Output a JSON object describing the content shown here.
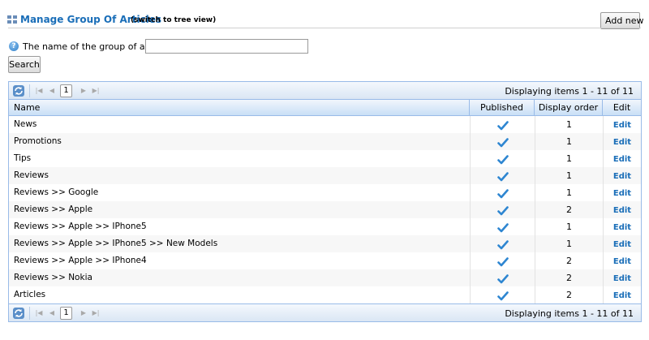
{
  "header": {
    "title": "Manage Group Of Articles",
    "switch_view": "(switch to tree view)",
    "add_new": "Add new"
  },
  "search": {
    "label": "The name of the group of articles:",
    "value": "",
    "button": "Search"
  },
  "pager": {
    "page": "1",
    "display": "Displaying items 1 - 11 of 11"
  },
  "columns": {
    "name": "Name",
    "published": "Published",
    "order": "Display order",
    "edit": "Edit"
  },
  "rows": [
    {
      "name": "News",
      "published": true,
      "order": "1",
      "edit": "Edit"
    },
    {
      "name": "Promotions",
      "published": true,
      "order": "1",
      "edit": "Edit"
    },
    {
      "name": "Tips",
      "published": true,
      "order": "1",
      "edit": "Edit"
    },
    {
      "name": "Reviews",
      "published": true,
      "order": "1",
      "edit": "Edit"
    },
    {
      "name": "Reviews >> Google",
      "published": true,
      "order": "1",
      "edit": "Edit"
    },
    {
      "name": "Reviews >> Apple",
      "published": true,
      "order": "2",
      "edit": "Edit"
    },
    {
      "name": "Reviews >> Apple >> IPhone5",
      "published": true,
      "order": "1",
      "edit": "Edit"
    },
    {
      "name": "Reviews >> Apple >> IPhone5 >> New Models",
      "published": true,
      "order": "1",
      "edit": "Edit"
    },
    {
      "name": "Reviews >> Apple >> IPhone4",
      "published": true,
      "order": "2",
      "edit": "Edit"
    },
    {
      "name": "Reviews >> Nokia",
      "published": true,
      "order": "2",
      "edit": "Edit"
    },
    {
      "name": "Articles",
      "published": true,
      "order": "2",
      "edit": "Edit"
    }
  ],
  "colors": {
    "accent": "#1a6eb8",
    "grid_border": "#99bbe8",
    "check": "#2e86d1"
  }
}
